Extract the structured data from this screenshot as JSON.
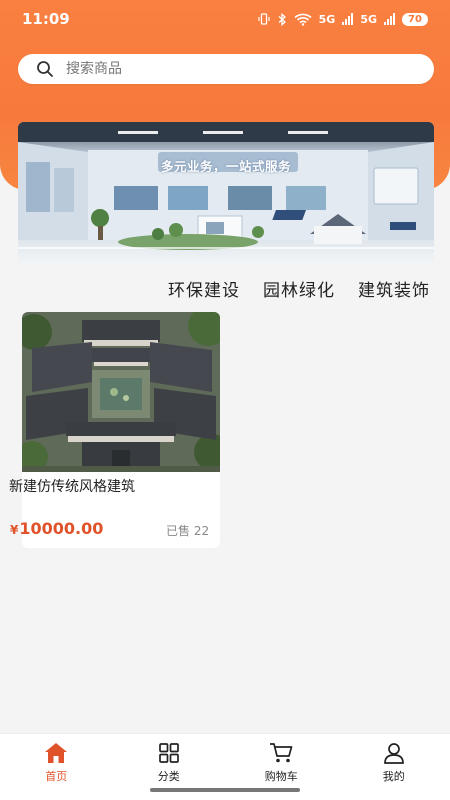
{
  "status_bar": {
    "time": "11:09",
    "network_1": "5G",
    "network_2": "5G",
    "battery": "70"
  },
  "search": {
    "placeholder": "搜索商品",
    "value": ""
  },
  "banner": {
    "title": "多元业务，一站式服务"
  },
  "categories": [
    {
      "label": "环保建设"
    },
    {
      "label": "园林绿化"
    },
    {
      "label": "建筑装饰"
    }
  ],
  "products": [
    {
      "name": "新建仿传统风格建筑",
      "currency": "¥",
      "price": "10000.00",
      "sold": "已售 22"
    }
  ],
  "tab_bar": {
    "items": [
      {
        "label": "首页",
        "icon": "home-icon",
        "active": true
      },
      {
        "label": "分类",
        "icon": "grid-icon",
        "active": false
      },
      {
        "label": "购物车",
        "icon": "cart-icon",
        "active": false
      },
      {
        "label": "我的",
        "icon": "user-icon",
        "active": false
      }
    ]
  },
  "colors": {
    "brand_orange": "#f77a3d",
    "price_red": "#e0532a"
  }
}
